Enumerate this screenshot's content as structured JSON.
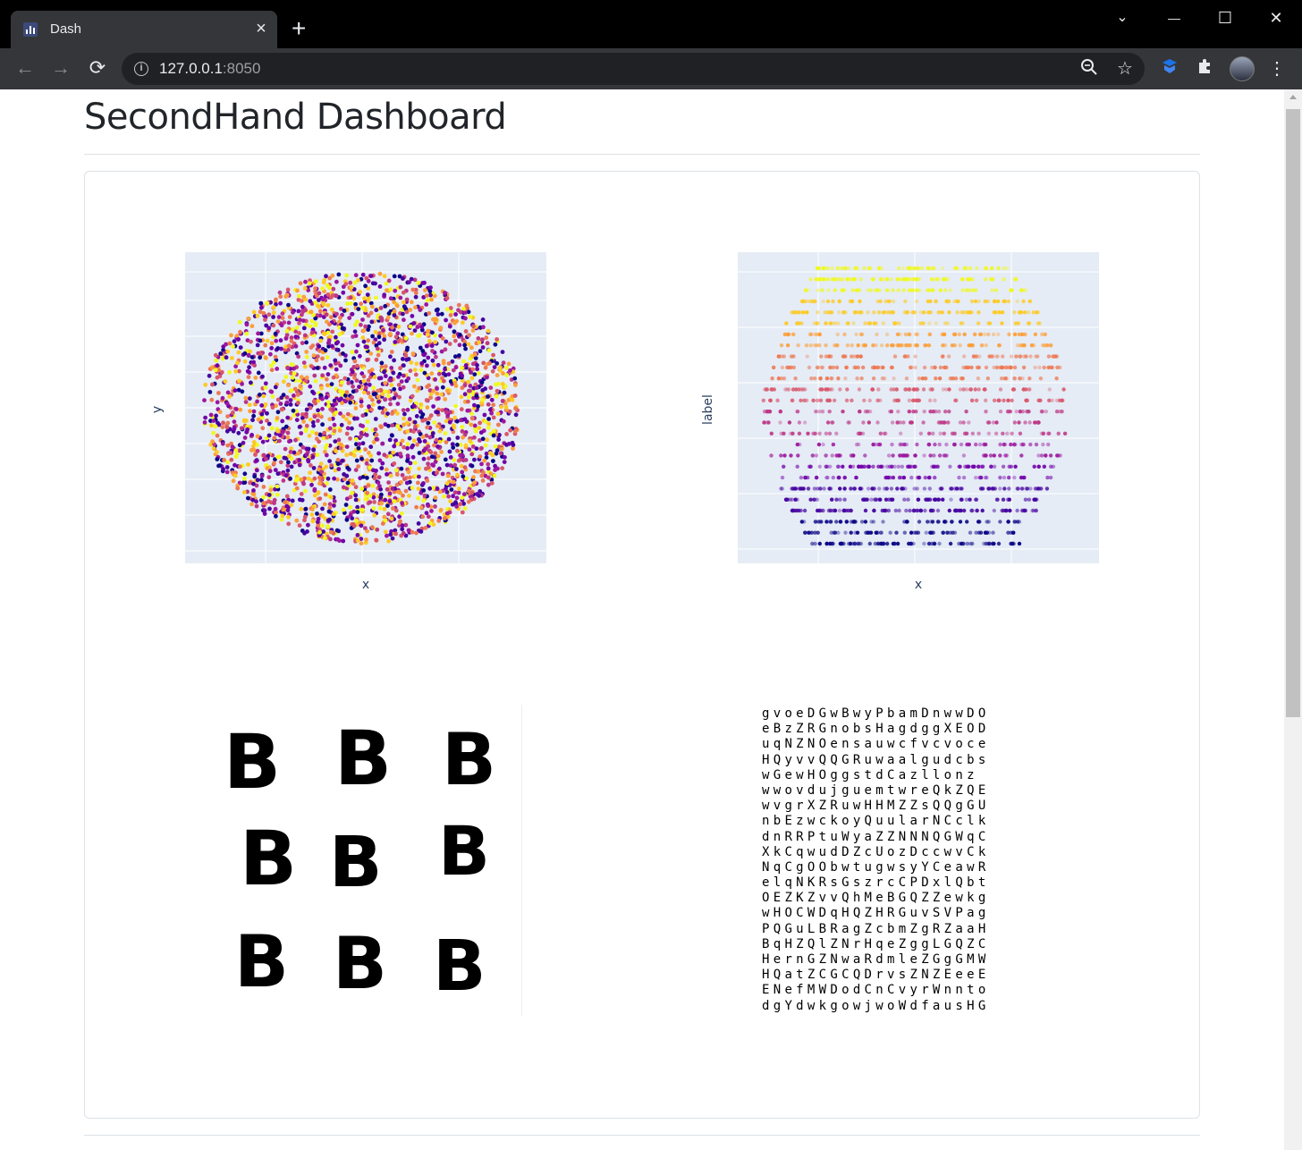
{
  "browser": {
    "tab_title": "Dash",
    "tab_close": "×",
    "new_tab": "+",
    "window_controls": {
      "dropdown": "⌄",
      "minimize": "—",
      "maximize": "☐",
      "close": "✕"
    },
    "nav": {
      "back": "←",
      "forward": "→",
      "reload": "⟳"
    },
    "url_host": "127.0.0.1",
    "url_port": ":8050",
    "omnibox_icons": [
      "zoom-icon",
      "star-icon"
    ],
    "extension_icons": [
      "shield-extension-icon",
      "puzzle-extension-icon"
    ],
    "menu": "⋮"
  },
  "page": {
    "title": "SecondHand Dashboard"
  },
  "plots": {
    "scatter_xy": {
      "xlabel": "x",
      "ylabel": "y"
    },
    "scatter_label": {
      "xlabel": "x",
      "ylabel": "label"
    }
  },
  "colors": {
    "plot_bg": "#e5ecf6",
    "grid": "#ffffff",
    "axis_text": "#2a3f5f",
    "colorscale": [
      "#0d0887",
      "#46039f",
      "#7201a8",
      "#9c179e",
      "#bd3786",
      "#d8576b",
      "#ed7953",
      "#fb9f3a",
      "#fdca26",
      "#f0f921"
    ]
  },
  "images": {
    "sample_letter": "B",
    "letter_grid_rows": [
      "gvoeDGwBwyPbamDnwwDO",
      "eBzZRGnobsHagdggXEOD",
      "uqNZNOensauwcfvcvoce",
      "HQyvvQQGRuwaalgudcbs",
      "wGewHOggstdCazllonz",
      "wwovdujguemtwreQkZQE",
      "wvgrXZRuwHHMZZsQQgGU",
      "nbEzwckoyQuularNCclk",
      "dnRRPtuWyaZZNNNQGWqC",
      "XkCqwudDZcUozDccwvCk",
      "NqCgOObwtugwsyYCeawR",
      "elqNKRsGszrcCPDxlQbt",
      "OEZKZvvQhMeBGQZZewkg",
      "wHOCWDqHQZHRGuvSVPag",
      "PQGuLBRagZcbmZgRZaaH",
      "BqHZQlZNrHqeZggLGQZC",
      "HernGZNwaRdmleZGgGMW",
      "HQatZCGCQDrvsZNZEeeE",
      "ENefMWDodCnCvyrWnnto",
      "dgYdwkgowjwoWdfausHG"
    ]
  }
}
